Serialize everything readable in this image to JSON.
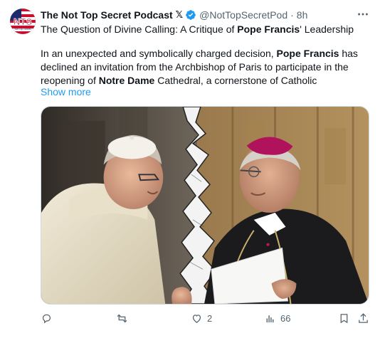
{
  "author": {
    "display_name": "The Not Top Secret Podcast",
    "x_badge": "𝕏",
    "handle": "@NotTopSecretPod",
    "separator": "·",
    "time": "8h",
    "avatar_text": "NTS",
    "avatar_subtext": "Not Top Secret"
  },
  "post": {
    "title_before": "The Question of Divine Calling: A Critique of ",
    "title_bold": "Pope Francis",
    "title_after": "' Leadership",
    "p1": "In an unexpected and symbolically charged decision, ",
    "p1_bold": "Pope Francis",
    "p2": " has declined an invitation from the Archbishop of Paris to participate in the reopening of ",
    "p2_bold": "Notre Dame",
    "p3": " Cathedral, a cornerstone of Catholic",
    "show_more": "Show more"
  },
  "actions": {
    "reply_count": "",
    "repost_count": "",
    "like_count": "2",
    "views_count": "66"
  },
  "colors": {
    "accent": "#1d9bf0",
    "secondary_text": "#536471",
    "verified": "#1d9bf0"
  },
  "icons": [
    "reply-icon",
    "repost-icon",
    "like-icon",
    "views-icon",
    "bookmark-icon",
    "share-icon",
    "more-icon",
    "verified-icon"
  ]
}
